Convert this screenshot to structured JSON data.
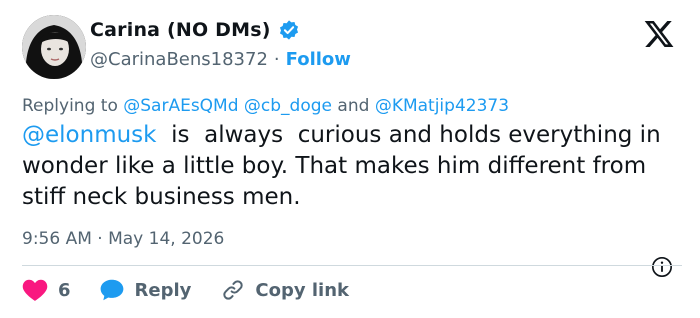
{
  "author": {
    "display_name": "Carina (NO DMs)",
    "handle": "@CarinaBens18372",
    "separator": "·",
    "follow_label": "Follow",
    "verified_icon": "verified-badge-icon"
  },
  "replying": {
    "prefix": "Replying to",
    "mentions": [
      "@SarAEsQMd",
      "@cb_doge",
      "@KMatjip42373"
    ],
    "joiner": "and"
  },
  "tweet": {
    "mention": "@elonmusk",
    "text": "  is  always  curious and holds everything in wonder like a little boy. That makes him different from stiff neck business men."
  },
  "meta": {
    "timestamp": "9:56 AM · May 14, 2026"
  },
  "actions": {
    "like_count": "6",
    "reply_label": "Reply",
    "copy_link_label": "Copy link"
  },
  "colors": {
    "accent": "#1d9bf0",
    "muted": "#536471",
    "like": "#f91880"
  }
}
